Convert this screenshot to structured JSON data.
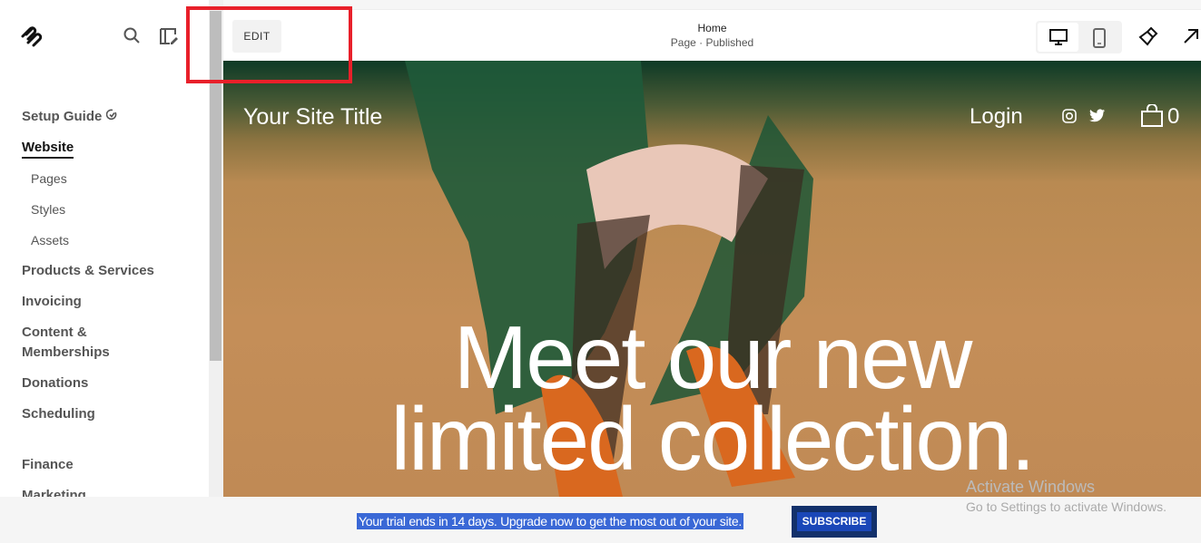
{
  "sidebar": {
    "items": [
      {
        "label": "Setup Guide",
        "type": "main"
      },
      {
        "label": "Website",
        "type": "main",
        "active": true
      },
      {
        "label": "Pages",
        "type": "sub"
      },
      {
        "label": "Styles",
        "type": "sub"
      },
      {
        "label": "Assets",
        "type": "sub"
      },
      {
        "label": "Products & Services",
        "type": "main"
      },
      {
        "label": "Invoicing",
        "type": "main"
      },
      {
        "label": "Content &",
        "type": "main2"
      },
      {
        "label": "Memberships",
        "type": "main"
      },
      {
        "label": "Donations",
        "type": "main"
      },
      {
        "label": "Scheduling",
        "type": "main"
      },
      {
        "label": "",
        "type": "gap"
      },
      {
        "label": "Finance",
        "type": "main"
      },
      {
        "label": "Marketing",
        "type": "main"
      }
    ]
  },
  "toolbar": {
    "edit_label": "EDIT",
    "page_title": "Home",
    "page_status": "Page · Published"
  },
  "site": {
    "title": "Your Site Title",
    "login": "Login",
    "cart_count": "0",
    "headline_1": "Meet our new",
    "headline_2": "limited collection."
  },
  "banner": {
    "trial_text": "Your trial ends in 14 days. Upgrade now to get the most out of your site.",
    "subscribe_label": "SUBSCRIBE"
  },
  "watermark": {
    "line1": "Activate Windows",
    "line2": "Go to Settings to activate Windows."
  },
  "colors": {
    "highlight_box": "#e8202a",
    "subscribe_bg": "#1a47b8",
    "trial_highlight": "#3a68d6"
  }
}
